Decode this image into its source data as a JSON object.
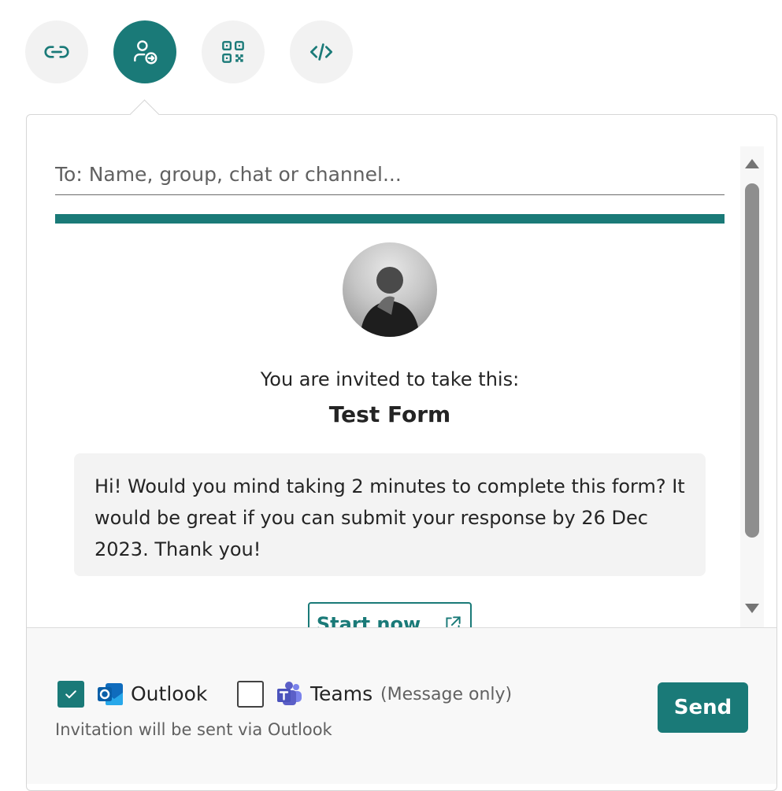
{
  "share_options": [
    {
      "name": "link-icon",
      "active": false
    },
    {
      "name": "invite-person-icon",
      "active": true
    },
    {
      "name": "qr-code-icon",
      "active": false
    },
    {
      "name": "embed-code-icon",
      "active": false
    }
  ],
  "recipient": {
    "placeholder": "To: Name, group, chat or channel...",
    "value": ""
  },
  "preview": {
    "invite_text": "You are invited to take this:",
    "form_title": "Test Form",
    "message": "Hi! Would you mind taking 2 minutes to complete this form? It would be great if you can submit your response by 26 Dec 2023. Thank you!",
    "start_button_label": "Start now",
    "start_icon": "open-external-icon"
  },
  "channels": {
    "outlook": {
      "label": "Outlook",
      "checked": true,
      "icon": "outlook-icon"
    },
    "teams": {
      "label": "Teams",
      "note": "(Message only)",
      "checked": false,
      "icon": "teams-icon"
    }
  },
  "hint": "Invitation will be sent via Outlook",
  "send_label": "Send",
  "colors": {
    "accent": "#1a7a78",
    "outlook_blue": "#0f6cbd",
    "teams_purple": "#5b5fc7"
  }
}
